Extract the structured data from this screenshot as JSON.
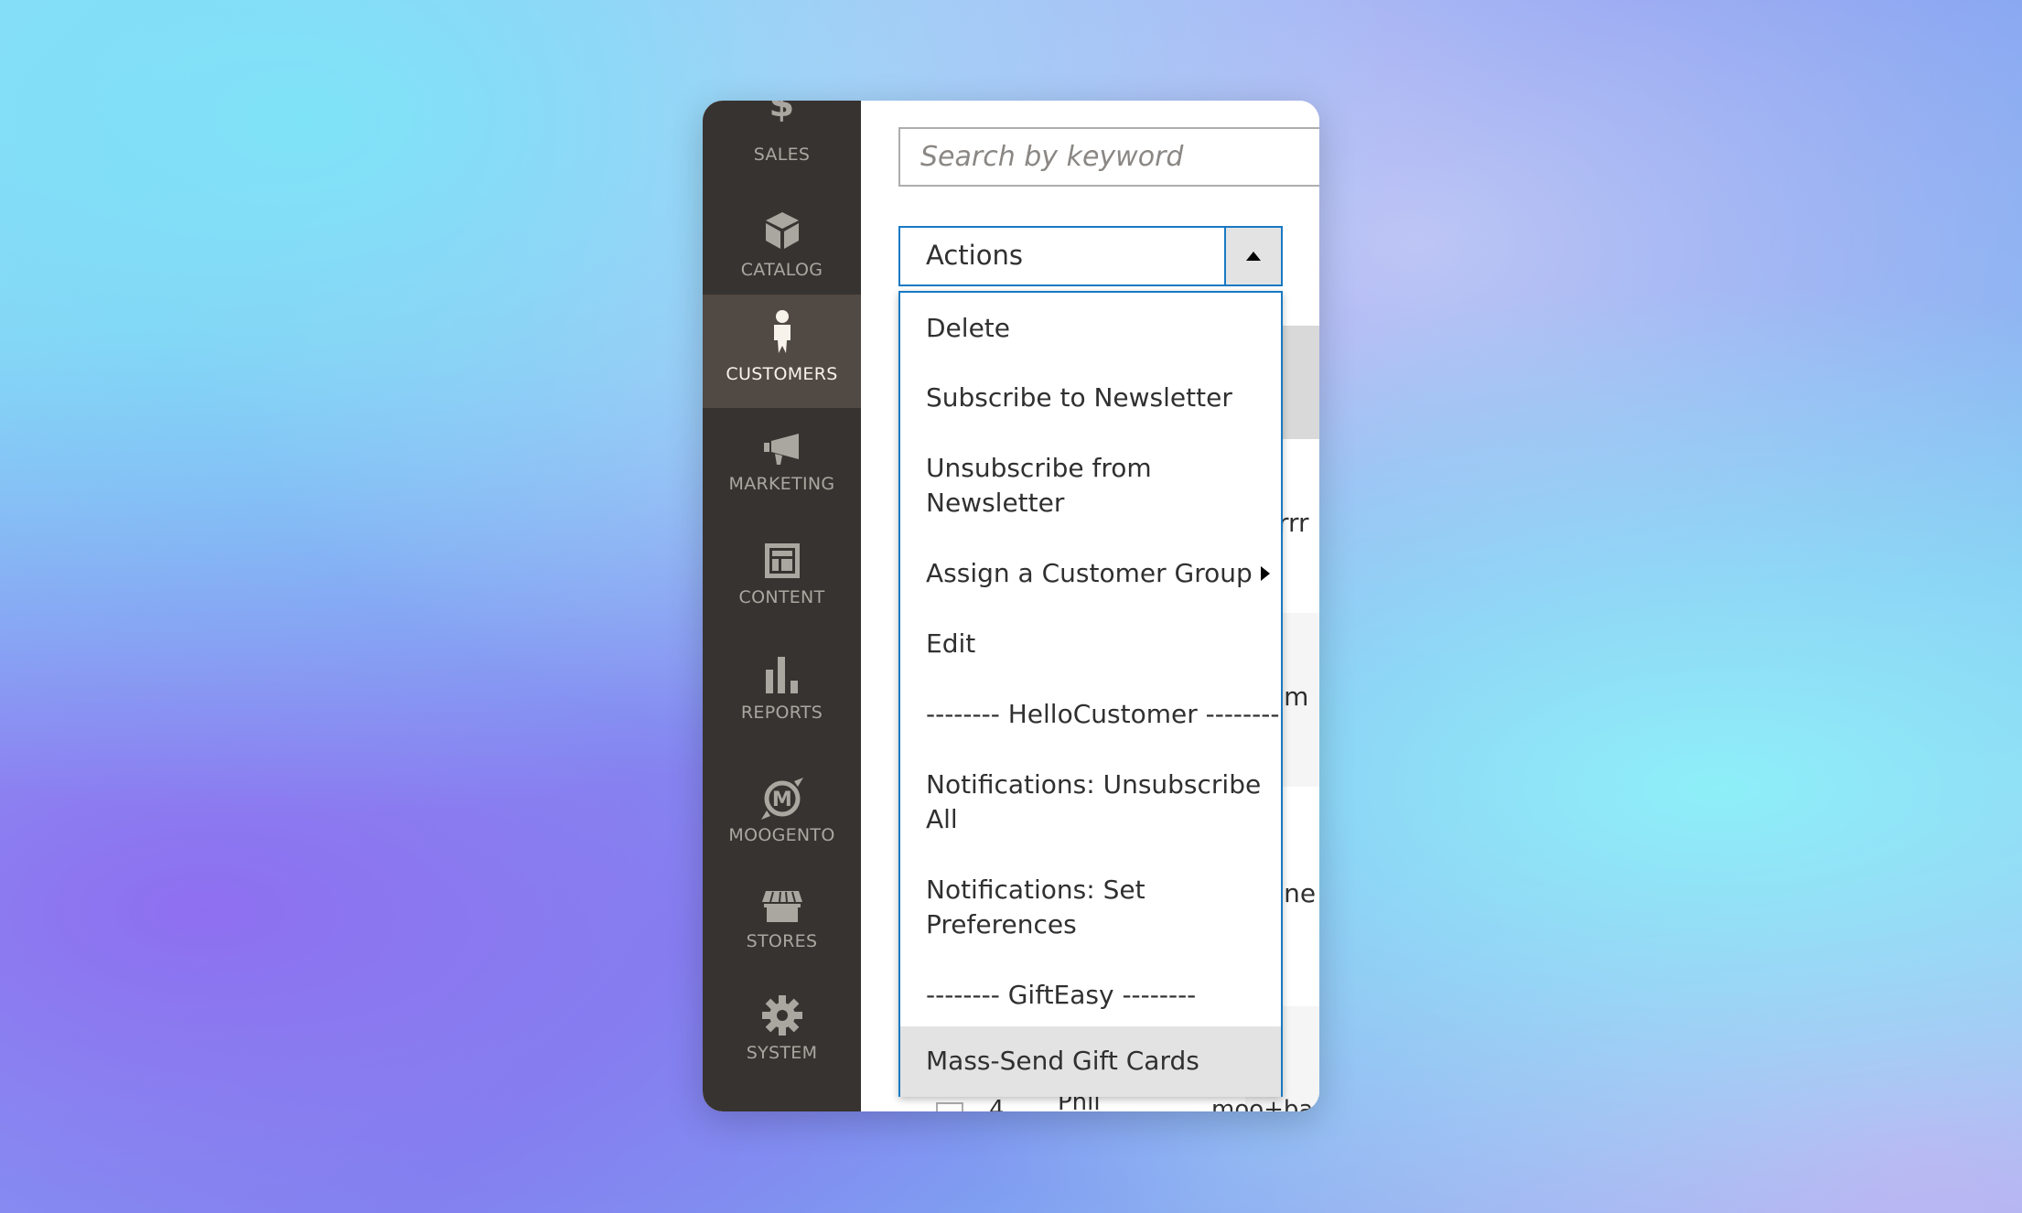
{
  "sidebar": {
    "items": [
      {
        "label": "SALES",
        "icon": "dollar-icon"
      },
      {
        "label": "CATALOG",
        "icon": "box-icon"
      },
      {
        "label": "CUSTOMERS",
        "icon": "person-icon",
        "active": true
      },
      {
        "label": "MARKETING",
        "icon": "megaphone-icon"
      },
      {
        "label": "CONTENT",
        "icon": "layout-icon"
      },
      {
        "label": "REPORTS",
        "icon": "bar-chart-icon"
      },
      {
        "label": "MOOGENTO",
        "icon": "moogento-logo-icon"
      },
      {
        "label": "STORES",
        "icon": "storefront-icon"
      },
      {
        "label": "SYSTEM",
        "icon": "gear-icon"
      }
    ]
  },
  "search": {
    "placeholder": "Search by keyword"
  },
  "actions": {
    "label": "Actions",
    "expanded": true,
    "items": [
      {
        "label": "Delete"
      },
      {
        "label": "Subscribe to Newsletter"
      },
      {
        "label": "Unsubscribe from Newsletter"
      },
      {
        "label": "Assign a Customer Group",
        "submenu": true
      },
      {
        "label": "Edit"
      },
      {
        "label": "-------- HelloCustomer --------"
      },
      {
        "label": "Notifications: Unsubscribe All"
      },
      {
        "label": "Notifications: Set Preferences"
      },
      {
        "label": "-------- GiftEasy --------"
      },
      {
        "label": "Mass-Send Gift Cards",
        "highlighted": true
      }
    ]
  },
  "grid_fragments": {
    "row1": "rrrr",
    "row2": "am",
    "row3": "ane",
    "last_row_id": "4",
    "last_row_name": "Phil",
    "last_row_email": "moo+bad"
  },
  "colors": {
    "sidebar": "#373330",
    "sidebar_active": "#514943",
    "focus_border": "#1979c3",
    "highlight": "#e3e3e3"
  }
}
